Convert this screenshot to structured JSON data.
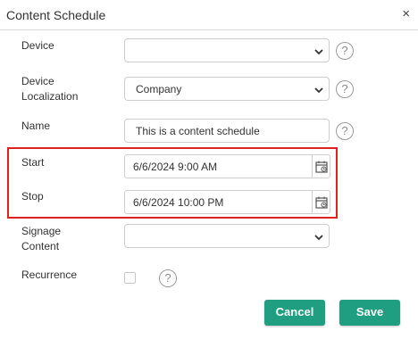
{
  "dialog": {
    "title": "Content Schedule",
    "close_glyph": "×"
  },
  "fields": {
    "device": {
      "label": "Device",
      "value": ""
    },
    "device_localization": {
      "label_line1": "Device",
      "label_line2": "Localization",
      "value": "Company"
    },
    "name": {
      "label": "Name",
      "value": "This is a content schedule"
    },
    "start": {
      "label": "Start",
      "value": "6/6/2024 9:00 AM"
    },
    "stop": {
      "label": "Stop",
      "value": "6/6/2024 10:00 PM"
    },
    "signage_content": {
      "label_line1": "Signage",
      "label_line2": "Content",
      "value": ""
    },
    "recurrence": {
      "label": "Recurrence",
      "checked": false
    }
  },
  "help_glyph": "?",
  "buttons": {
    "cancel": "Cancel",
    "save": "Save"
  },
  "icons": {
    "close": "close-icon",
    "dropdown": "chevron-down-icon",
    "help": "question-circle-icon",
    "calendar": "calendar-icon"
  },
  "colors": {
    "accent": "#1f9e82",
    "highlight": "#e0211f"
  }
}
